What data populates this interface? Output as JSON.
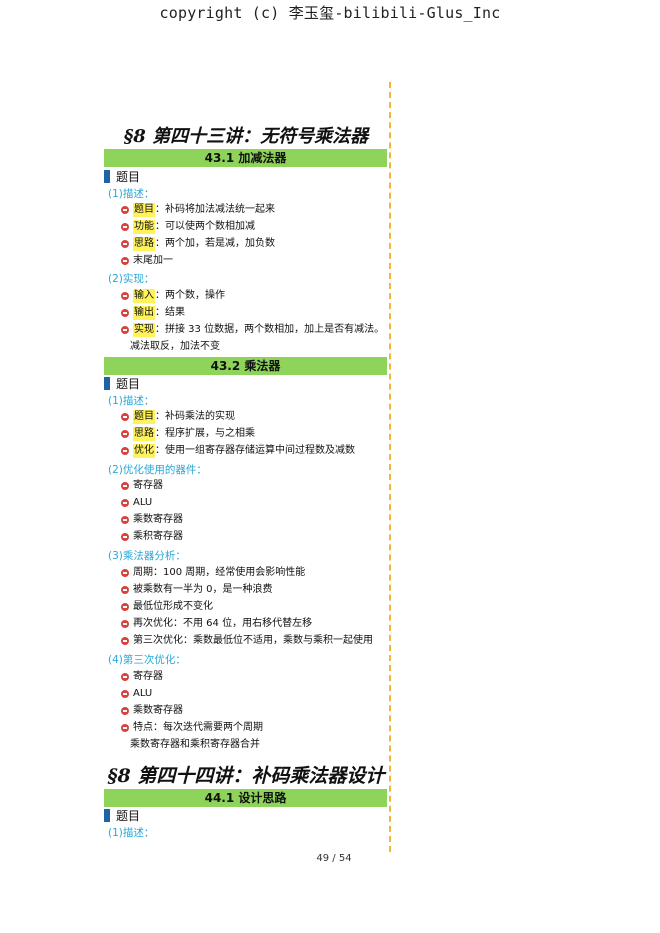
{
  "header": {
    "copyright": "copyright (c) 李玉玺-bilibili-Glus_Inc"
  },
  "ch43": {
    "title": "§8 第四十三讲：无符号乘法器",
    "s1": {
      "bar": "43.1 加减法器",
      "topic": "题目",
      "desc": "(1)描述：",
      "items": [
        {
          "key": "题目",
          "text": "：补码将加法减法统一起来"
        },
        {
          "key": "功能",
          "text": "：可以使两个数相加减"
        },
        {
          "key": "思路",
          "text": "：两个加，若是减，加负数"
        },
        {
          "key": "",
          "text": "末尾加一"
        }
      ],
      "impl": "(2)实现：",
      "impl_items": [
        {
          "key": "输入",
          "text": "：两个数，操作"
        },
        {
          "key": "输出",
          "text": "：结果"
        },
        {
          "key": "实现",
          "text": "：拼接 33 位数据，两个数相加，加上是否有减法。"
        }
      ],
      "impl_cont": "减法取反，加法不变"
    },
    "s2": {
      "bar": "43.2 乘法器",
      "topic": "题目",
      "desc": "(1)描述：",
      "items": [
        {
          "key": "题目",
          "text": "：补码乘法的实现"
        },
        {
          "key": "思路",
          "text": "：程序扩展，与之相乘"
        },
        {
          "key": "优化",
          "text": "：使用一组寄存器存储运算中间过程数及减数"
        }
      ],
      "parts": "(2)优化使用的器件：",
      "parts_items": [
        "寄存器",
        "ALU",
        "乘数寄存器",
        "乘积寄存器"
      ],
      "analysis": "(3)乘法器分析：",
      "analysis_items": [
        "周期：100 周期，经常使用会影响性能",
        "被乘数有一半为 0，是一种浪费",
        "最低位形成不变化",
        "再次优化：不用 64 位，用右移代替左移",
        "第三次优化：乘数最低位不适用，乘数与乘积一起使用"
      ],
      "third": "(4)第三次优化：",
      "third_items": [
        "寄存器",
        "ALU",
        "乘数寄存器",
        "特点：每次迭代需要两个周期"
      ],
      "third_cont": "乘数寄存器和乘积寄存器合并"
    }
  },
  "ch44": {
    "title": "§8 第四十四讲：补码乘法器设计",
    "s1": {
      "bar": "44.1 设计思路",
      "topic": "题目",
      "desc": "(1)描述："
    }
  },
  "footer": {
    "page": "49 / 54"
  },
  "colors": {
    "bar": "#8fd45a",
    "accent": "#2aa7d6",
    "bullet": "#d9413c",
    "highlight": "#fff25a",
    "margin_line": "#f3b63a"
  }
}
